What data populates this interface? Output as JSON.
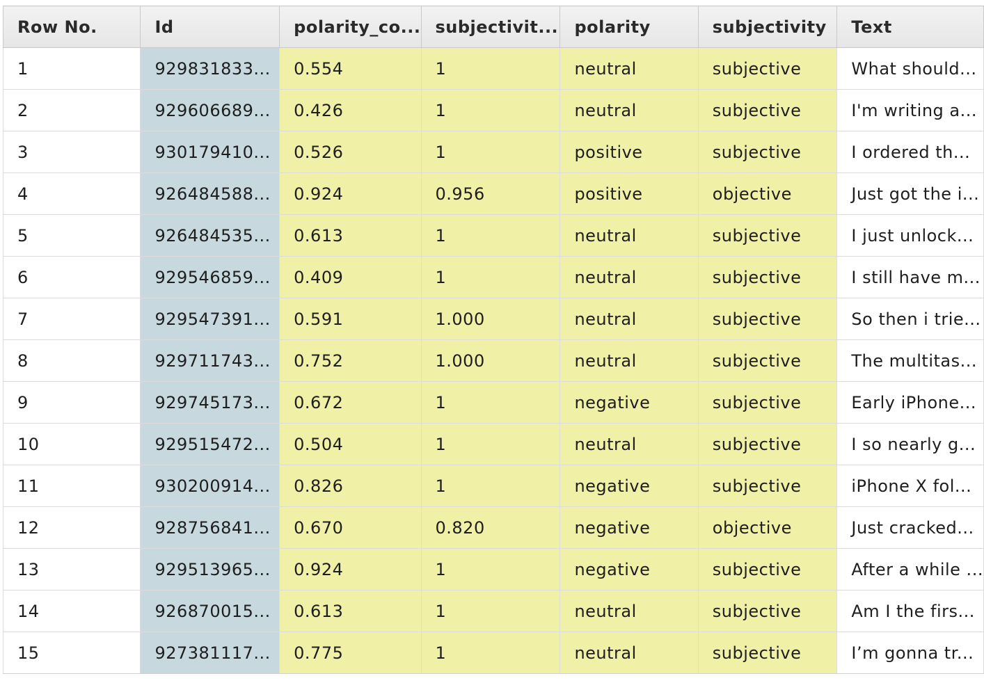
{
  "table": {
    "columns": [
      "Row No.",
      "Id",
      "polarity_co...",
      "subjectivit...",
      "polarity",
      "subjectivity",
      "Text"
    ],
    "rows": [
      [
        "1",
        "929831833...",
        "0.554",
        "1",
        "neutral",
        "subjective",
        "What should..."
      ],
      [
        "2",
        "929606689...",
        "0.426",
        "1",
        "neutral",
        "subjective",
        "I'm writing a..."
      ],
      [
        "3",
        "930179410...",
        "0.526",
        "1",
        "positive",
        "subjective",
        "I ordered th..."
      ],
      [
        "4",
        "926484588...",
        "0.924",
        "0.956",
        "positive",
        "objective",
        "Just got the i..."
      ],
      [
        "5",
        "926484535...",
        "0.613",
        "1",
        "neutral",
        "subjective",
        "I just unlock..."
      ],
      [
        "6",
        "929546859...",
        "0.409",
        "1",
        "neutral",
        "subjective",
        "I still have m..."
      ],
      [
        "7",
        "929547391...",
        "0.591",
        "1.000",
        "neutral",
        "subjective",
        "So then i trie..."
      ],
      [
        "8",
        "929711743...",
        "0.752",
        "1.000",
        "neutral",
        "subjective",
        "The multitas..."
      ],
      [
        "9",
        "929745173...",
        "0.672",
        "1",
        "negative",
        "subjective",
        "Early iPhone..."
      ],
      [
        "10",
        "929515472...",
        "0.504",
        "1",
        "neutral",
        "subjective",
        "I so nearly g..."
      ],
      [
        "11",
        "930200914...",
        "0.826",
        "1",
        "negative",
        "subjective",
        "iPhone X fol..."
      ],
      [
        "12",
        "928756841...",
        "0.670",
        "0.820",
        "negative",
        "objective",
        "Just cracked..."
      ],
      [
        "13",
        "929513965...",
        "0.924",
        "1",
        "negative",
        "subjective",
        "After a while ..."
      ],
      [
        "14",
        "926870015...",
        "0.613",
        "1",
        "neutral",
        "subjective",
        "Am I the firs..."
      ],
      [
        "15",
        "927381117...",
        "0.775",
        "1",
        "neutral",
        "subjective",
        "I’m gonna tr..."
      ]
    ]
  },
  "colors": {
    "header_bg": "#ececec",
    "id_column_bg": "#c7d9df",
    "highlight_columns_bg": "#f0f0a6",
    "grid_line": "#dcdcdc"
  }
}
